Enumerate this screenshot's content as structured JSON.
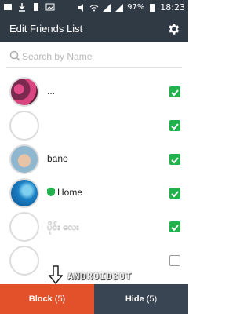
{
  "status_bar": {
    "battery": "97%",
    "time": "18:23"
  },
  "app_bar": {
    "title": "Edit Friends List",
    "settings_icon": "gear-icon"
  },
  "search": {
    "placeholder": "Search by Name",
    "value": ""
  },
  "friends": [
    {
      "name": "...",
      "checked": true
    },
    {
      "name": "",
      "checked": true
    },
    {
      "name": "bano",
      "checked": true
    },
    {
      "name": "Home",
      "checked": true,
      "verified": true
    },
    {
      "name": "ပိုင်း လေး",
      "checked": true
    },
    {
      "name": "",
      "checked": false
    }
  ],
  "actions": {
    "block_label": "Block",
    "block_count": "(5)",
    "hide_label": "Hide",
    "hide_count": "(5)"
  },
  "watermark": "ANDROID30T",
  "colors": {
    "appbar": "#2f3a45",
    "check": "#22b14c",
    "block": "#e2512a",
    "hide": "#394552"
  }
}
